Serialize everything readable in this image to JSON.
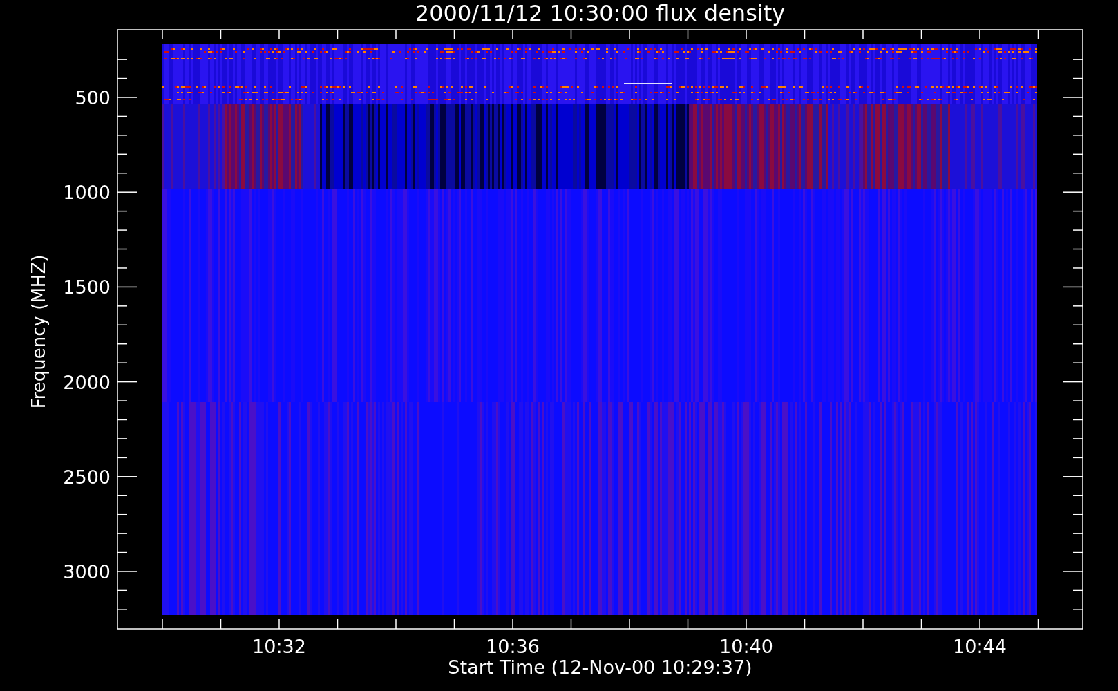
{
  "title": "2000/11/12 10:30:00 flux density",
  "y_axis": {
    "label": "Frequency (MHZ)",
    "tick_labels": [
      "500",
      "1000",
      "1500",
      "2000",
      "2500",
      "3000"
    ]
  },
  "x_axis": {
    "label": "Start Time (12-Nov-00 10:29:37)",
    "tick_labels": [
      "10:32",
      "10:36",
      "10:40",
      "10:44"
    ]
  }
}
